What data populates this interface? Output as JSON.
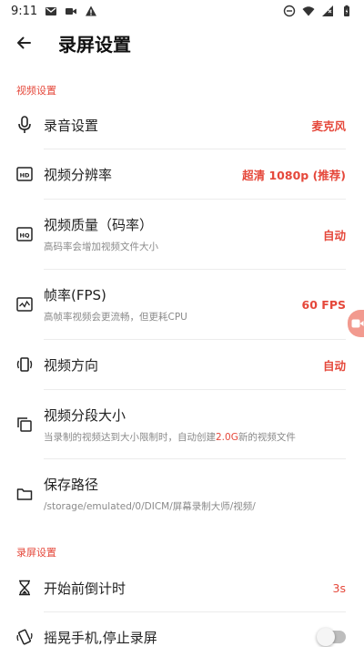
{
  "status_bar": {
    "time": "9:11"
  },
  "app_bar": {
    "title": "录屏设置"
  },
  "sections": {
    "video": "视频设置",
    "recording": "录屏设置"
  },
  "rows": {
    "audio": {
      "title": "录音设置",
      "value": "麦克风"
    },
    "resolution": {
      "title": "视频分辨率",
      "value": "超清 1080p (推荐)"
    },
    "quality": {
      "title": "视频质量（码率）",
      "subtitle": "高码率会增加视频文件大小",
      "value": "自动"
    },
    "fps": {
      "title": "帧率(FPS)",
      "subtitle": "高帧率视频会更流畅，但更耗CPU",
      "value": "60 FPS"
    },
    "orientation": {
      "title": "视频方向",
      "value": "自动"
    },
    "segment": {
      "title": "视频分段大小",
      "subtitle_pre": "当录制的视频达到大小限制时，自动创建",
      "subtitle_hl": "2.0G",
      "subtitle_post": "新的视频文件"
    },
    "path": {
      "title": "保存路径",
      "subtitle": "/storage/emulated/0/DICM/屏幕录制大师/视频/"
    },
    "countdown": {
      "title": "开始前倒计时",
      "value": "3s"
    },
    "shake": {
      "title": "摇晃手机,停止录屏",
      "enabled": false
    }
  }
}
